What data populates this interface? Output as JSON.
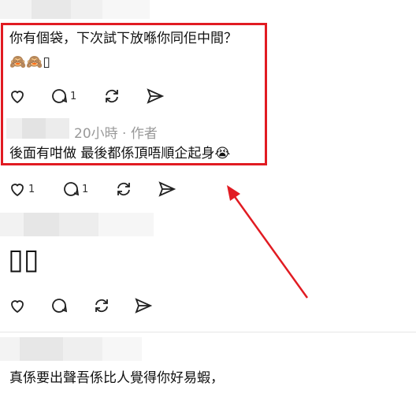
{
  "colors": {
    "highlight": "#e11b22",
    "arrow": "#e11b22"
  },
  "post_top": {
    "text": "你有個袋，下次試下放喺你同佢中間？",
    "emoji_line": "🙈🙈▯",
    "actions": {
      "likes": "",
      "replies": "1",
      "reposts": "",
      "shares": ""
    }
  },
  "reply": {
    "meta": "20小時 · 作者",
    "text": "後面有咁做 最後都係頂唔順企起身😭",
    "actions": {
      "likes": "1",
      "replies": "1"
    }
  },
  "post_mid": {
    "text": "▯▯"
  },
  "post_bottom": {
    "text": "真係要出聲吾係比人覺得你好易蝦，"
  },
  "icons": [
    "heart-icon",
    "comment-icon",
    "repost-icon",
    "share-icon"
  ]
}
